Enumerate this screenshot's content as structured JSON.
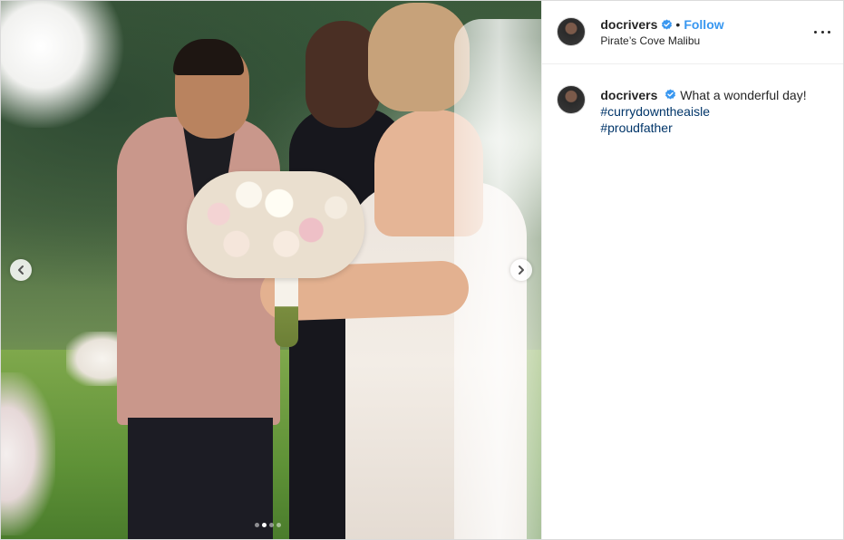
{
  "post": {
    "media": {
      "slide_count": 4,
      "active_slide": 2
    },
    "header": {
      "username": "docrivers",
      "separator": "•",
      "follow_label": "Follow",
      "location": "Pirate’s Cove Malibu"
    },
    "caption": {
      "username": "docrivers",
      "text": "What a wonderful day!",
      "hashtags": [
        "#currydowntheaisle",
        "#proudfather"
      ]
    },
    "colors": {
      "follow": "#3897f0",
      "hashtag": "#003569",
      "verified": "#3897f0"
    },
    "icons": {
      "verified": "verified-badge-icon",
      "prev": "chevron-left-icon",
      "next": "chevron-right-icon",
      "more": "more-options-icon"
    }
  }
}
